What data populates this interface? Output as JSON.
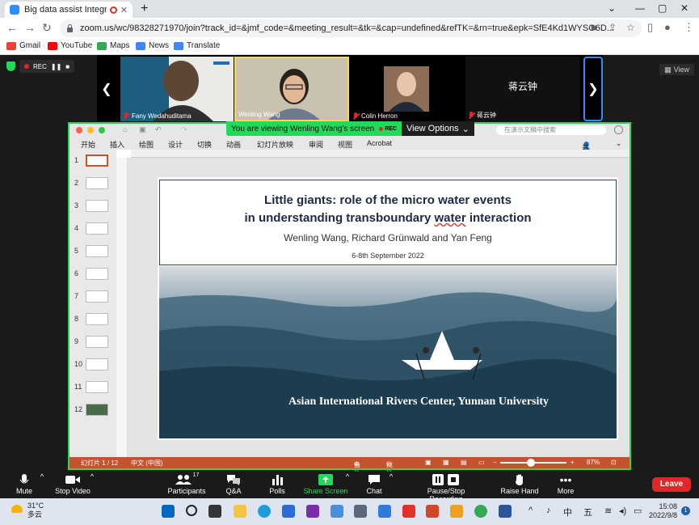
{
  "browser": {
    "tab_title": "Big data assist Integrated",
    "url": "zoom.us/wc/98328271970/join?track_id=&jmf_code=&meeting_result=&tk=&cap=undefined&refTK=&rn=true&epk=SfE4Kd1WYSO6D...",
    "bookmarks": [
      "Gmail",
      "YouTube",
      "Maps",
      "News",
      "Translate"
    ]
  },
  "zoom": {
    "rec_label": "REC",
    "view_label": "View",
    "participants": [
      {
        "name": "Fany Wedahuditama",
        "muted": true
      },
      {
        "name": "Wenling Wang",
        "muted": false
      },
      {
        "name": "Colin Herron",
        "muted": true
      },
      {
        "name": "蒋云钟",
        "muted": true
      }
    ],
    "big_name": "蒋云钟",
    "share_banner": "You are viewing Wenling Wang's screen",
    "share_rec": "REC",
    "view_options": "View Options",
    "toolbar": {
      "mute": "Mute",
      "stop_video": "Stop Video",
      "participants": "Participants",
      "participants_count": "17",
      "qa": "Q&A",
      "polls": "Polls",
      "share_screen": "Share Screen",
      "chat": "Chat",
      "recording": "Pause/Stop Recording",
      "raise_hand": "Raise Hand",
      "more": "More",
      "leave": "Leave"
    }
  },
  "ppt": {
    "search_placeholder": "在演示文稿中搜索",
    "menu": [
      "开始",
      "插入",
      "绘图",
      "设计",
      "切换",
      "动画",
      "幻灯片放映",
      "审阅",
      "视图",
      "Acrobat"
    ],
    "share": "共享",
    "thumbs": [
      "1",
      "2",
      "3",
      "4",
      "5",
      "6",
      "7",
      "8",
      "9",
      "10",
      "11",
      "12"
    ],
    "slide": {
      "title_line1": "Little giants: role of the micro water events",
      "title_line2_a": "in understanding transboundary ",
      "title_line2_b": "water",
      "title_line2_c": " interaction",
      "authors": "Wenling Wang, Richard Grünwald and Yan Feng",
      "date": "6-8th September 2022",
      "org": "Asian International Rivers Center, Yunnan University"
    },
    "status": {
      "slide_no": "幻灯片 1 / 12",
      "lang": "中文 (中国)",
      "notes": "备注",
      "comments": "批注",
      "zoom": "87%"
    }
  },
  "taskbar": {
    "temp": "31°C",
    "weather": "多云",
    "ime1": "中",
    "ime2": "五",
    "time": "15:08",
    "date": "2022/9/8",
    "notif": "1"
  },
  "colors": {
    "zoom_green": "#23d959",
    "ppt_orange": "#c4532e",
    "leave_red": "#e02828",
    "zoom_blue": "#2d8cff"
  }
}
